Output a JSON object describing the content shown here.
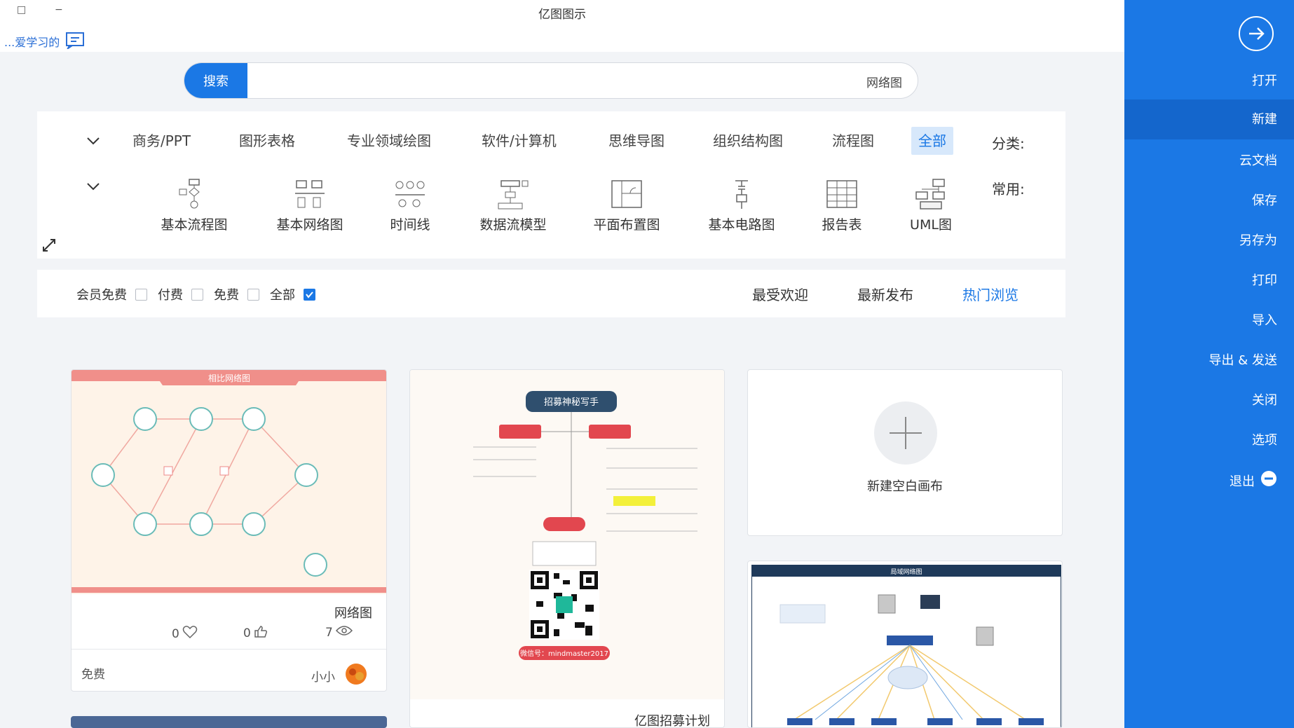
{
  "window": {
    "title": "亿图图示",
    "minimize": "−",
    "maximize": "□"
  },
  "feedback": {
    "label": "...爱学习的"
  },
  "sidebar": {
    "items": [
      {
        "label": "打开"
      },
      {
        "label": "新建"
      },
      {
        "label": "云文档"
      },
      {
        "label": "保存"
      },
      {
        "label": "另存为"
      },
      {
        "label": "打印"
      },
      {
        "label": "导入"
      },
      {
        "label": "导出 & 发送"
      },
      {
        "label": "关闭"
      },
      {
        "label": "选项"
      },
      {
        "label": "退出"
      }
    ]
  },
  "search": {
    "button": "搜索",
    "value": "网络图"
  },
  "categories": {
    "label": "分类:",
    "tabs": [
      "全部",
      "流程图",
      "组织结构图",
      "思维导图",
      "软件/计算机",
      "专业领域绘图",
      "图形表格",
      "商务/PPT"
    ],
    "common_label": "常用:",
    "common": [
      "UML图",
      "报告表",
      "基本电路图",
      "平面布置图",
      "数据流模型",
      "时间线",
      "基本网络图",
      "基本流程图"
    ]
  },
  "sort": {
    "tabs": [
      "热门浏览",
      "最新发布",
      "最受欢迎"
    ]
  },
  "filters": [
    {
      "label": "全部",
      "checked": true
    },
    {
      "label": "免费",
      "checked": false
    },
    {
      "label": "付费",
      "checked": false
    },
    {
      "label": "会员免费",
      "checked": false
    }
  ],
  "cards": {
    "new_canvas": {
      "label": "新建空白画布"
    },
    "network": {
      "banner": "相比网络图",
      "title": "网络图",
      "views": "7",
      "likes": "0",
      "favorites": "0",
      "author": "小小",
      "price": "免费"
    },
    "recruit": {
      "title": "亿图招募计划",
      "header": "招募神秘写手",
      "handle": "微信号：mindmaster2017"
    },
    "lan": {
      "header": "局域网络图"
    }
  },
  "colors": {
    "accent": "#1b78e5",
    "sidebar_active": "#1466cc"
  }
}
